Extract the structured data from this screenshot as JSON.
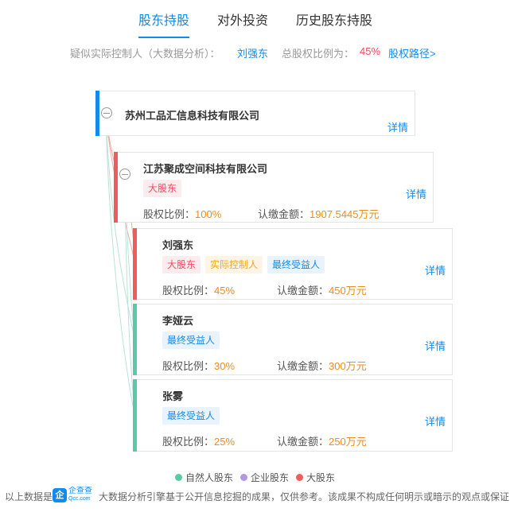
{
  "tabs": [
    {
      "label": "股东持股",
      "active": true
    },
    {
      "label": "对外投资",
      "active": false
    },
    {
      "label": "历史股东持股",
      "active": false
    }
  ],
  "info": {
    "controller_label": "疑似实际控制人（大数据分析）：",
    "controller_name": "刘强东",
    "ratio_label": "总股权比例为：",
    "ratio_value": "45%",
    "path_link": "股权路径>"
  },
  "root": {
    "name": "苏州工品汇信息科技有限公司",
    "detail": "详情"
  },
  "shareholders": [
    {
      "name": "江苏聚成空间科技有限公司",
      "tags": [
        {
          "text": "大股东",
          "kind": "big"
        }
      ],
      "ratio_label": "股权比例：",
      "ratio": "100%",
      "amount_label": "认缴金额：",
      "amount": "1907.5445万元",
      "detail": "详情",
      "bar_color": "#f25b5b"
    },
    {
      "name": "刘强东",
      "tags": [
        {
          "text": "大股东",
          "kind": "big"
        },
        {
          "text": "实际控制人",
          "kind": "ctrl"
        },
        {
          "text": "最终受益人",
          "kind": "benef"
        }
      ],
      "ratio_label": "股权比例：",
      "ratio": "45%",
      "amount_label": "认缴金额：",
      "amount": "450万元",
      "detail": "详情",
      "bar_color": "#f25b5b"
    },
    {
      "name": "李娅云",
      "tags": [
        {
          "text": "最终受益人",
          "kind": "benef"
        }
      ],
      "ratio_label": "股权比例：",
      "ratio": "30%",
      "amount_label": "认缴金额：",
      "amount": "300万元",
      "detail": "详情",
      "bar_color": "#5bc9a5"
    },
    {
      "name": "张雾",
      "tags": [
        {
          "text": "最终受益人",
          "kind": "benef"
        }
      ],
      "ratio_label": "股权比例：",
      "ratio": "25%",
      "amount_label": "认缴金额：",
      "amount": "250万元",
      "detail": "详情",
      "bar_color": "#5bc9a5"
    }
  ],
  "legend": [
    {
      "label": "自然人股东",
      "color": "#5bc9a5"
    },
    {
      "label": "企业股东",
      "color": "#b497e0"
    },
    {
      "label": "大股东",
      "color": "#f25b5b"
    }
  ],
  "footer": {
    "prefix": "以上数据是",
    "logo_mark": "企",
    "logo_name": "企查查",
    "logo_sub": "Qcc.com",
    "text": "大数据分析引擎基于公开信息挖掘的成果，仅供参考。该成果不构成任何明示或暗示的观点或保证"
  },
  "colors": {
    "accent": "#128bed",
    "root_bar": "#128bed",
    "red": "#fd485e",
    "orange": "#f08c1e"
  }
}
